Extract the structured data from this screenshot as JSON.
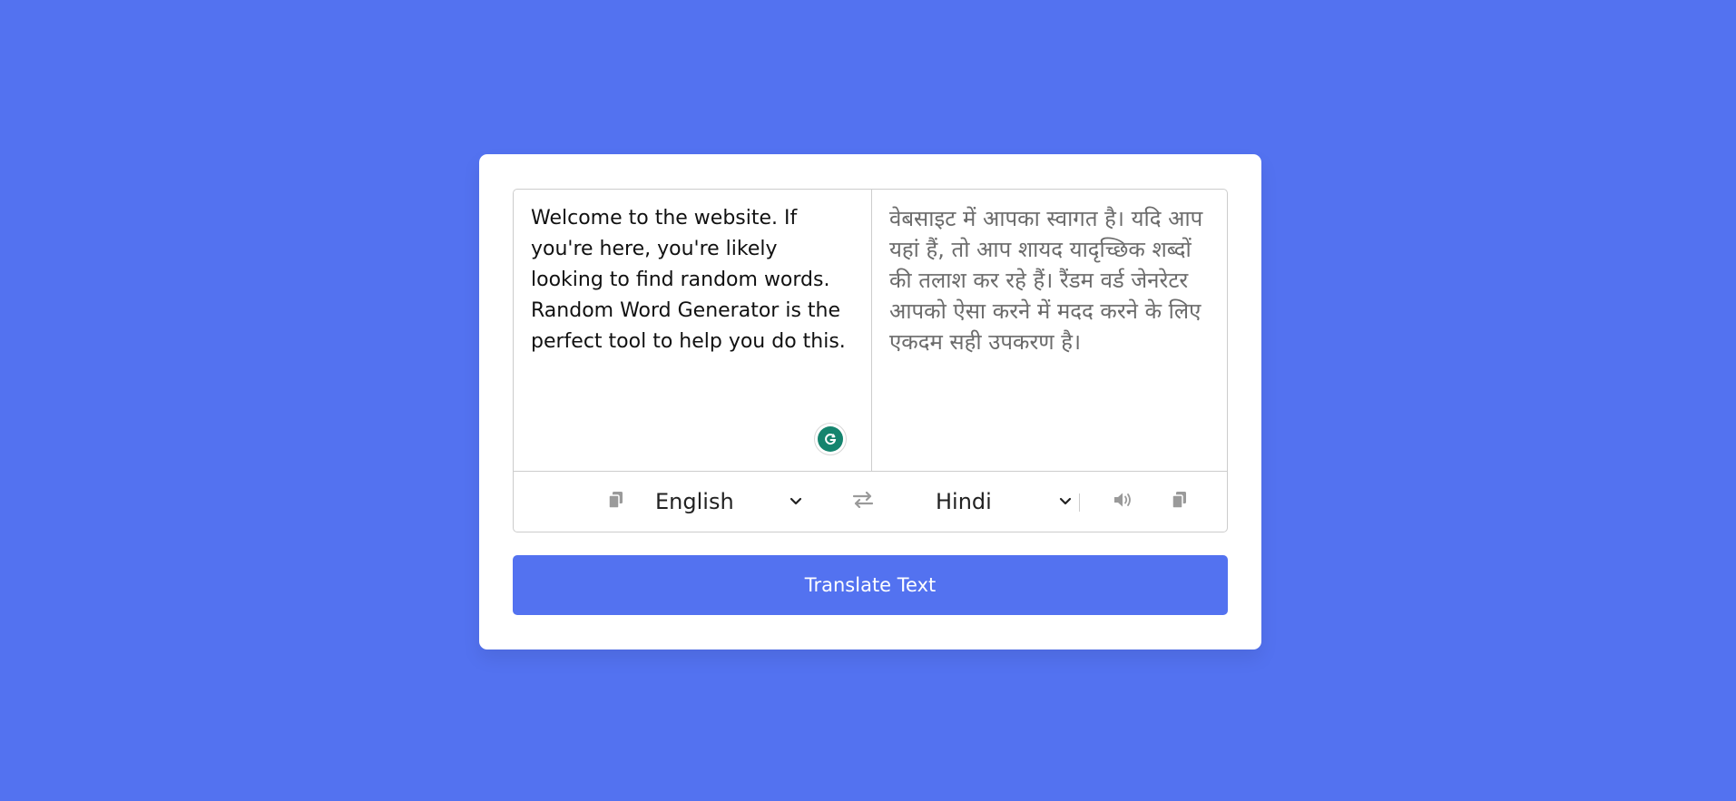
{
  "source": {
    "text": "Welcome to the website. If you're here, you're likely looking to find random words. Random Word Generator is the perfect tool to help you do this."
  },
  "target": {
    "text": "वेबसाइट में आपका स्वागत है। यदि आप यहां हैं, तो आप शायद यादृच्छिक शब्दों की तलाश कर रहे हैं। रैंडम वर्ड जेनरेटर आपको ऐसा करने में मदद करने के लिए एकदम सही उपकरण है।"
  },
  "controls": {
    "from_language": "English",
    "to_language": "Hindi"
  },
  "button": {
    "translate_label": "Translate Text"
  },
  "icons": {
    "copy_from": "copy-icon",
    "exchange": "exchange-icon",
    "speak_to": "volume-icon",
    "copy_to": "copy-icon",
    "grammarly": "grammarly-icon"
  },
  "colors": {
    "background": "#5372f0",
    "button": "#5372f0",
    "card": "#ffffff",
    "grammarly": "#15846e"
  }
}
